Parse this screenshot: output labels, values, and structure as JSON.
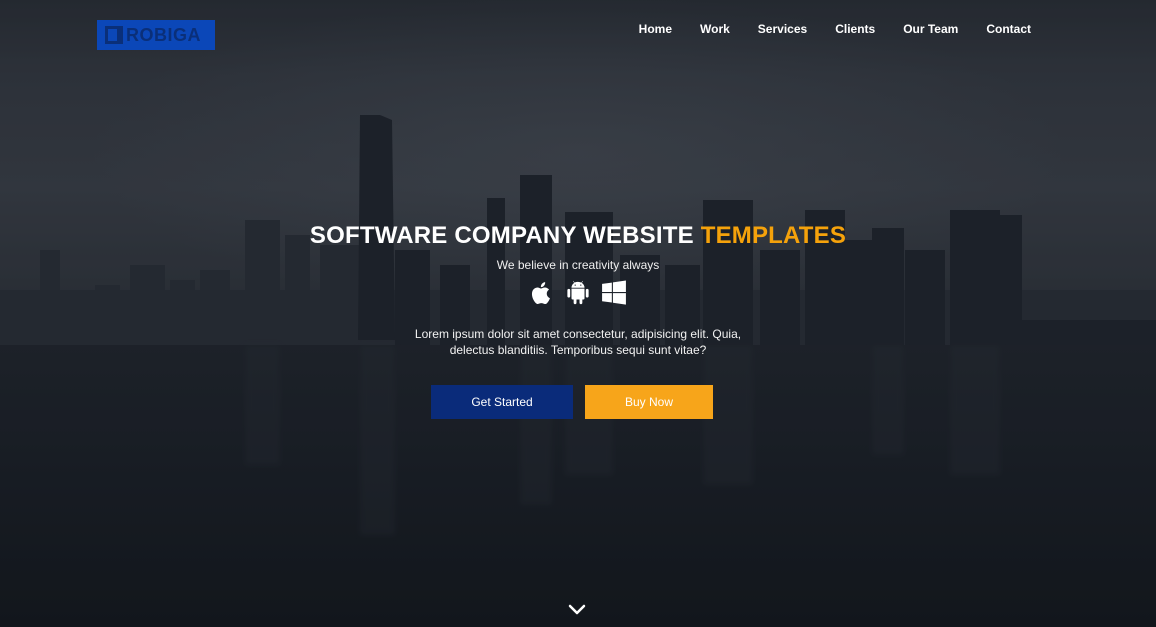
{
  "brand": {
    "logo_text": "ROBIGA"
  },
  "nav": {
    "items": [
      "Home",
      "Work",
      "Services",
      "Clients",
      "Our Team",
      "Contact"
    ]
  },
  "hero": {
    "headline_main": "SOFTWARE COMPANY WEBSITE",
    "headline_accent": "TEMPLATES",
    "tagline": "We believe in creativity always",
    "platform_icons": [
      "apple-icon",
      "android-icon",
      "windows-icon"
    ],
    "description_line1": "Lorem ipsum dolor sit amet consectetur, adipisicing elit. Quia,",
    "description_line2": "delectus blanditiis. Temporibus sequi sunt vitae?",
    "primary_button": "Get Started",
    "secondary_button": "Buy Now",
    "scroll_icon": "chevron-down-icon"
  },
  "colors": {
    "accent": "#f5a20b",
    "primary": "#0a2b7a",
    "secondary": "#f7a51a",
    "logo_bg": "#0b47b8"
  }
}
